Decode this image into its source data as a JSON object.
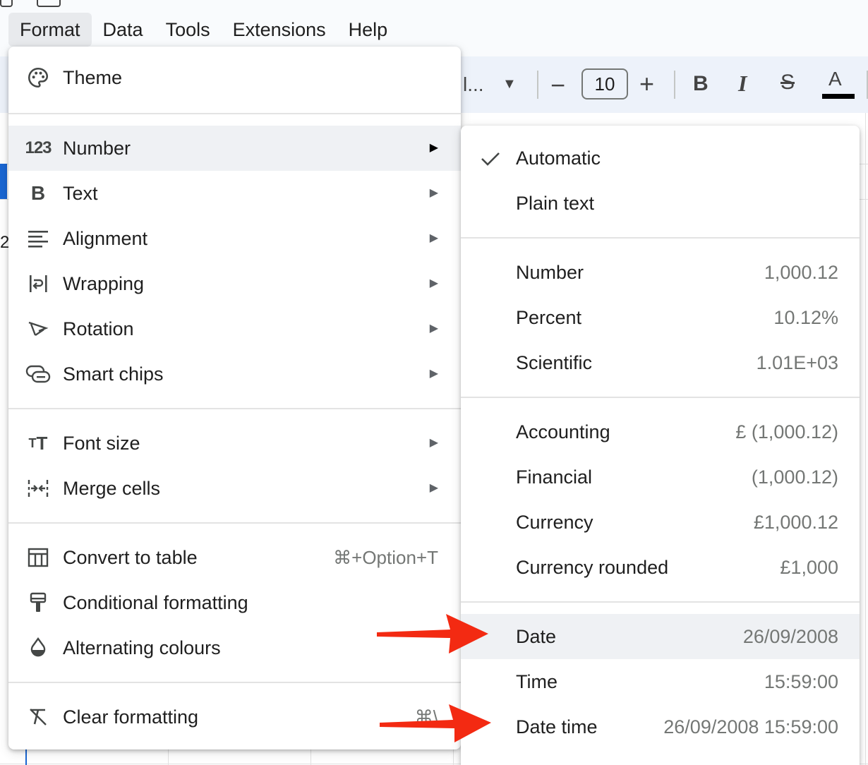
{
  "menubar": {
    "items": [
      {
        "label": "Format",
        "active": true
      },
      {
        "label": "Data"
      },
      {
        "label": "Tools"
      },
      {
        "label": "Extensions"
      },
      {
        "label": "Help"
      }
    ]
  },
  "toolbar": {
    "font_name_partial": "l...",
    "font_size": "10",
    "minus": "−",
    "plus": "+",
    "bold": "B",
    "italic": "I",
    "strike": "S",
    "text_color": "A",
    "text_color_value": "#000000"
  },
  "row_label_partial": "2",
  "format_menu": {
    "theme": "Theme",
    "number": "Number",
    "text": "Text",
    "alignment": "Alignment",
    "wrapping": "Wrapping",
    "rotation": "Rotation",
    "smart_chips": "Smart chips",
    "font_size": "Font size",
    "merge_cells": "Merge cells",
    "convert_to_table": "Convert to table",
    "convert_to_table_shortcut": "⌘+Option+T",
    "conditional_formatting": "Conditional formatting",
    "alternating_colours": "Alternating colours",
    "clear_formatting": "Clear formatting",
    "clear_formatting_shortcut": "⌘\\"
  },
  "number_submenu": {
    "automatic": "Automatic",
    "plain_text": "Plain text",
    "items": [
      {
        "label": "Number",
        "example": "1,000.12"
      },
      {
        "label": "Percent",
        "example": "10.12%"
      },
      {
        "label": "Scientific",
        "example": "1.01E+03"
      },
      {
        "label": "Accounting",
        "example": "£ (1,000.12)"
      },
      {
        "label": "Financial",
        "example": "(1,000.12)"
      },
      {
        "label": "Currency",
        "example": "£1,000.12"
      },
      {
        "label": "Currency rounded",
        "example": "£1,000"
      },
      {
        "label": "Date",
        "example": "26/09/2008"
      },
      {
        "label": "Time",
        "example": "15:59:00"
      },
      {
        "label": "Date time",
        "example": "26/09/2008 15:59:00"
      }
    ]
  },
  "colors": {
    "annotation_arrow": "#f32a12",
    "highlight": "#eff1f4",
    "selection": "#1a66d2"
  }
}
